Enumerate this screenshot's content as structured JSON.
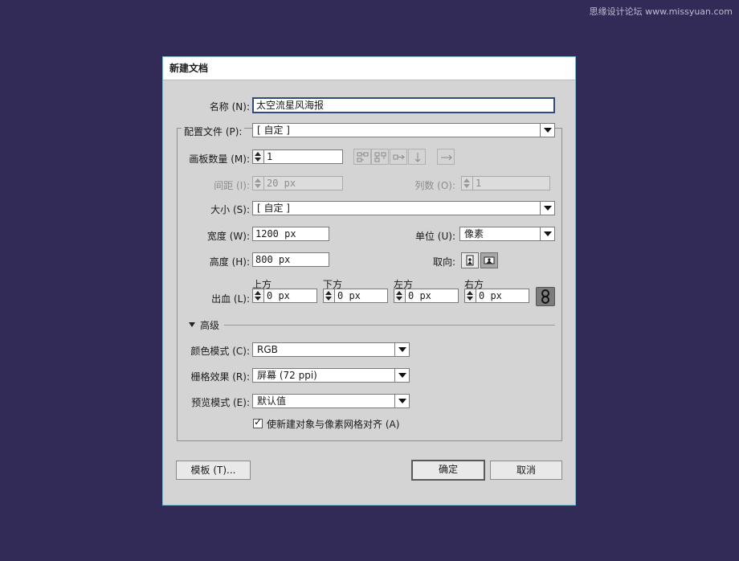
{
  "watermark": "思缘设计论坛 www.missyuan.com",
  "dialog": {
    "title": "新建文档",
    "name_label": "名称 (N):",
    "name_value": "太空流星风海报",
    "profile_label": "配置文件 (P):",
    "profile_value": "[ 自定 ]",
    "artboards_label": "画板数量 (M):",
    "artboards_value": "1",
    "spacing_label": "间距 (I):",
    "spacing_value": "20 px",
    "columns_label": "列数 (O):",
    "columns_value": "1",
    "size_label": "大小 (S):",
    "size_value": "[ 自定 ]",
    "width_label": "宽度 (W):",
    "width_value": "1200 px",
    "units_label": "单位 (U):",
    "units_value": "像素",
    "height_label": "高度 (H):",
    "height_value": "800 px",
    "orientation_label": "取向:",
    "bleed_label": "出血 (L):",
    "bleed": {
      "top_label": "上方",
      "top_value": "0 px",
      "bottom_label": "下方",
      "bottom_value": "0 px",
      "left_label": "左方",
      "left_value": "0 px",
      "right_label": "右方",
      "right_value": "0 px"
    },
    "advanced_label": "高级",
    "color_mode_label": "颜色模式 (C):",
    "color_mode_value": "RGB",
    "raster_label": "栅格效果 (R):",
    "raster_value": "屏幕 (72 ppi)",
    "preview_label": "预览模式 (E):",
    "preview_value": "默认值",
    "align_checkbox_label": "使新建对象与像素网格对齐 (A)",
    "align_checked": true,
    "templates_button": "模板 (T)...",
    "ok_button": "确定",
    "cancel_button": "取消"
  },
  "colors": {
    "background": "#332b57",
    "dialog_bg": "#d4d4d4",
    "dialog_border": "#7fb6cf"
  }
}
